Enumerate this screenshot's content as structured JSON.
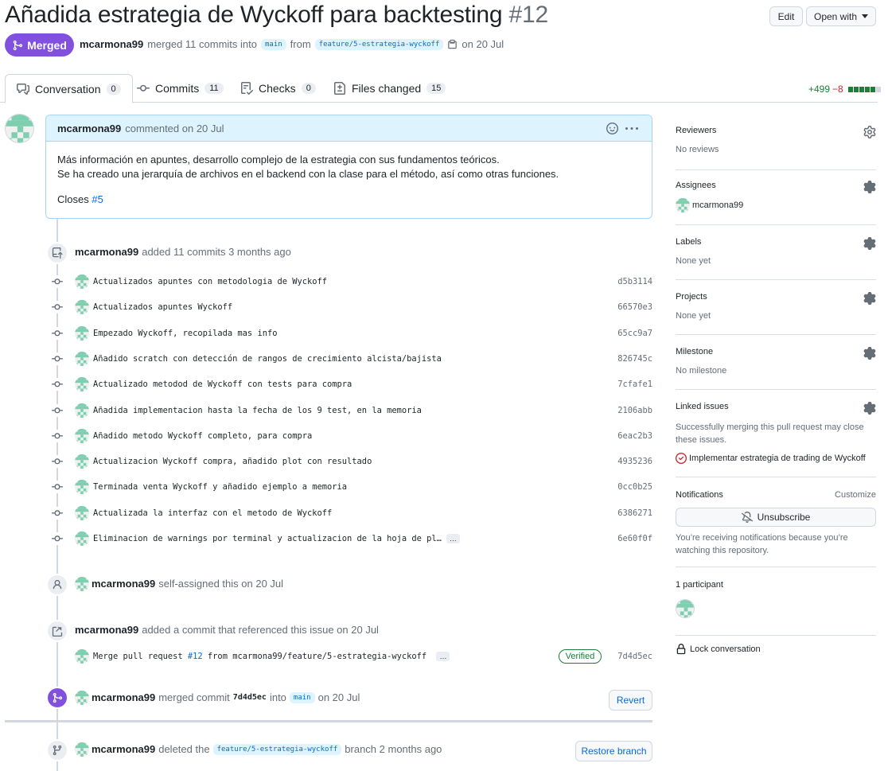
{
  "header": {
    "title": "Añadida estrategia de Wyckoff para backtesting",
    "number": "#12",
    "edit_label": "Edit",
    "open_with_label": "Open with",
    "status_label": "Merged",
    "author": "mcarmona99",
    "merged_text": "merged 11 commits into",
    "base_branch": "main",
    "from_text": "from",
    "head_branch": "feature/5-estrategia-wyckoff",
    "date_text": "on 20 Jul"
  },
  "tabs": [
    {
      "label": "Conversation",
      "count": "0"
    },
    {
      "label": "Commits",
      "count": "11"
    },
    {
      "label": "Checks",
      "count": "0"
    },
    {
      "label": "Files changed",
      "count": "15"
    }
  ],
  "diffstat": {
    "additions": "+499",
    "deletions": "−8"
  },
  "comment": {
    "author": "mcarmona99",
    "meta": "commented on 20 Jul",
    "line1": "Más información en apuntes, desarrollo complejo de la estrategia con sus fundamentos teóricos.",
    "line2": "Se ha creado una jerarquía de archivos en el backend con la clase para el método, así como otras funciones.",
    "closes_text": "Closes",
    "closes_ref": "#5"
  },
  "commits_event": {
    "author": "mcarmona99",
    "text": "added 11 commits 3 months ago"
  },
  "commits": [
    {
      "msg": "Actualizados apuntes con metodologia de Wyckoff",
      "sha": "d5b3114"
    },
    {
      "msg": "Actualizados apuntes Wyckoff",
      "sha": "66570e3"
    },
    {
      "msg": "Empezado Wyckoff, recopilada mas info",
      "sha": "65cc9a7"
    },
    {
      "msg": "Añadido scratch con detección de rangos de crecimiento alcista/bajista",
      "sha": "826745c"
    },
    {
      "msg": "Actualizado metodod de Wyckoff con tests para compra",
      "sha": "7cfafe1"
    },
    {
      "msg": "Añadida implementacion hasta la fecha de los 9 test, en la memoria",
      "sha": "2106abb"
    },
    {
      "msg": "Añadido metodo Wyckoff completo, para compra",
      "sha": "6eac2b3"
    },
    {
      "msg": "Actualizacion Wyckoff compra, añadido plot con resultado",
      "sha": "4935236"
    },
    {
      "msg": "Terminada venta Wyckoff y añadido ejemplo a memoria",
      "sha": "0cc0b25"
    },
    {
      "msg": "Actualizada la interfaz con el metodo de Wyckoff",
      "sha": "6386271"
    },
    {
      "msg": "Eliminacion de warnings por terminal y actualizacion de la hoja de pl…",
      "sha": "6e60f0f"
    }
  ],
  "assign_event": {
    "author": "mcarmona99",
    "text": "self-assigned this on 20 Jul"
  },
  "ref_event": {
    "author": "mcarmona99",
    "text": "added a commit that referenced this issue on 20 Jul",
    "commit_prefix": "Merge pull request",
    "commit_ref": "#12",
    "commit_suffix": "from mcarmona99/feature/5-estrategia-wyckoff",
    "verified": "Verified",
    "sha": "7d4d5ec"
  },
  "merge_event": {
    "author": "mcarmona99",
    "text": "merged commit",
    "sha": "7d4d5ec",
    "into": "into",
    "branch": "main",
    "date": "on 20 Jul",
    "revert_label": "Revert"
  },
  "delete_event": {
    "author": "mcarmona99",
    "text": "deleted the",
    "branch": "feature/5-estrategia-wyckoff",
    "suffix": "branch 2 months ago",
    "restore_label": "Restore branch"
  },
  "sidebar": {
    "reviewers": {
      "title": "Reviewers",
      "value": "No reviews"
    },
    "assignees": {
      "title": "Assignees",
      "value": "mcarmona99"
    },
    "labels": {
      "title": "Labels",
      "value": "None yet"
    },
    "projects": {
      "title": "Projects",
      "value": "None yet"
    },
    "milestone": {
      "title": "Milestone",
      "value": "No milestone"
    },
    "linked": {
      "title": "Linked issues",
      "desc1": "Successfully merging this pull request may close",
      "desc2": "these issues.",
      "issue": "Implementar estrategia de trading de Wyckoff"
    },
    "notifications": {
      "title": "Notifications",
      "customize": "Customize",
      "unsubscribe": "Unsubscribe",
      "reason1": "You’re receiving notifications because you’re",
      "reason2": "watching this repository."
    },
    "participants": {
      "title": "1 participant"
    },
    "lock_label": "Lock conversation"
  },
  "colors": {
    "merged": "#8250df",
    "link": "#0969da",
    "add": "#1a7f37",
    "del": "#cf222e"
  }
}
